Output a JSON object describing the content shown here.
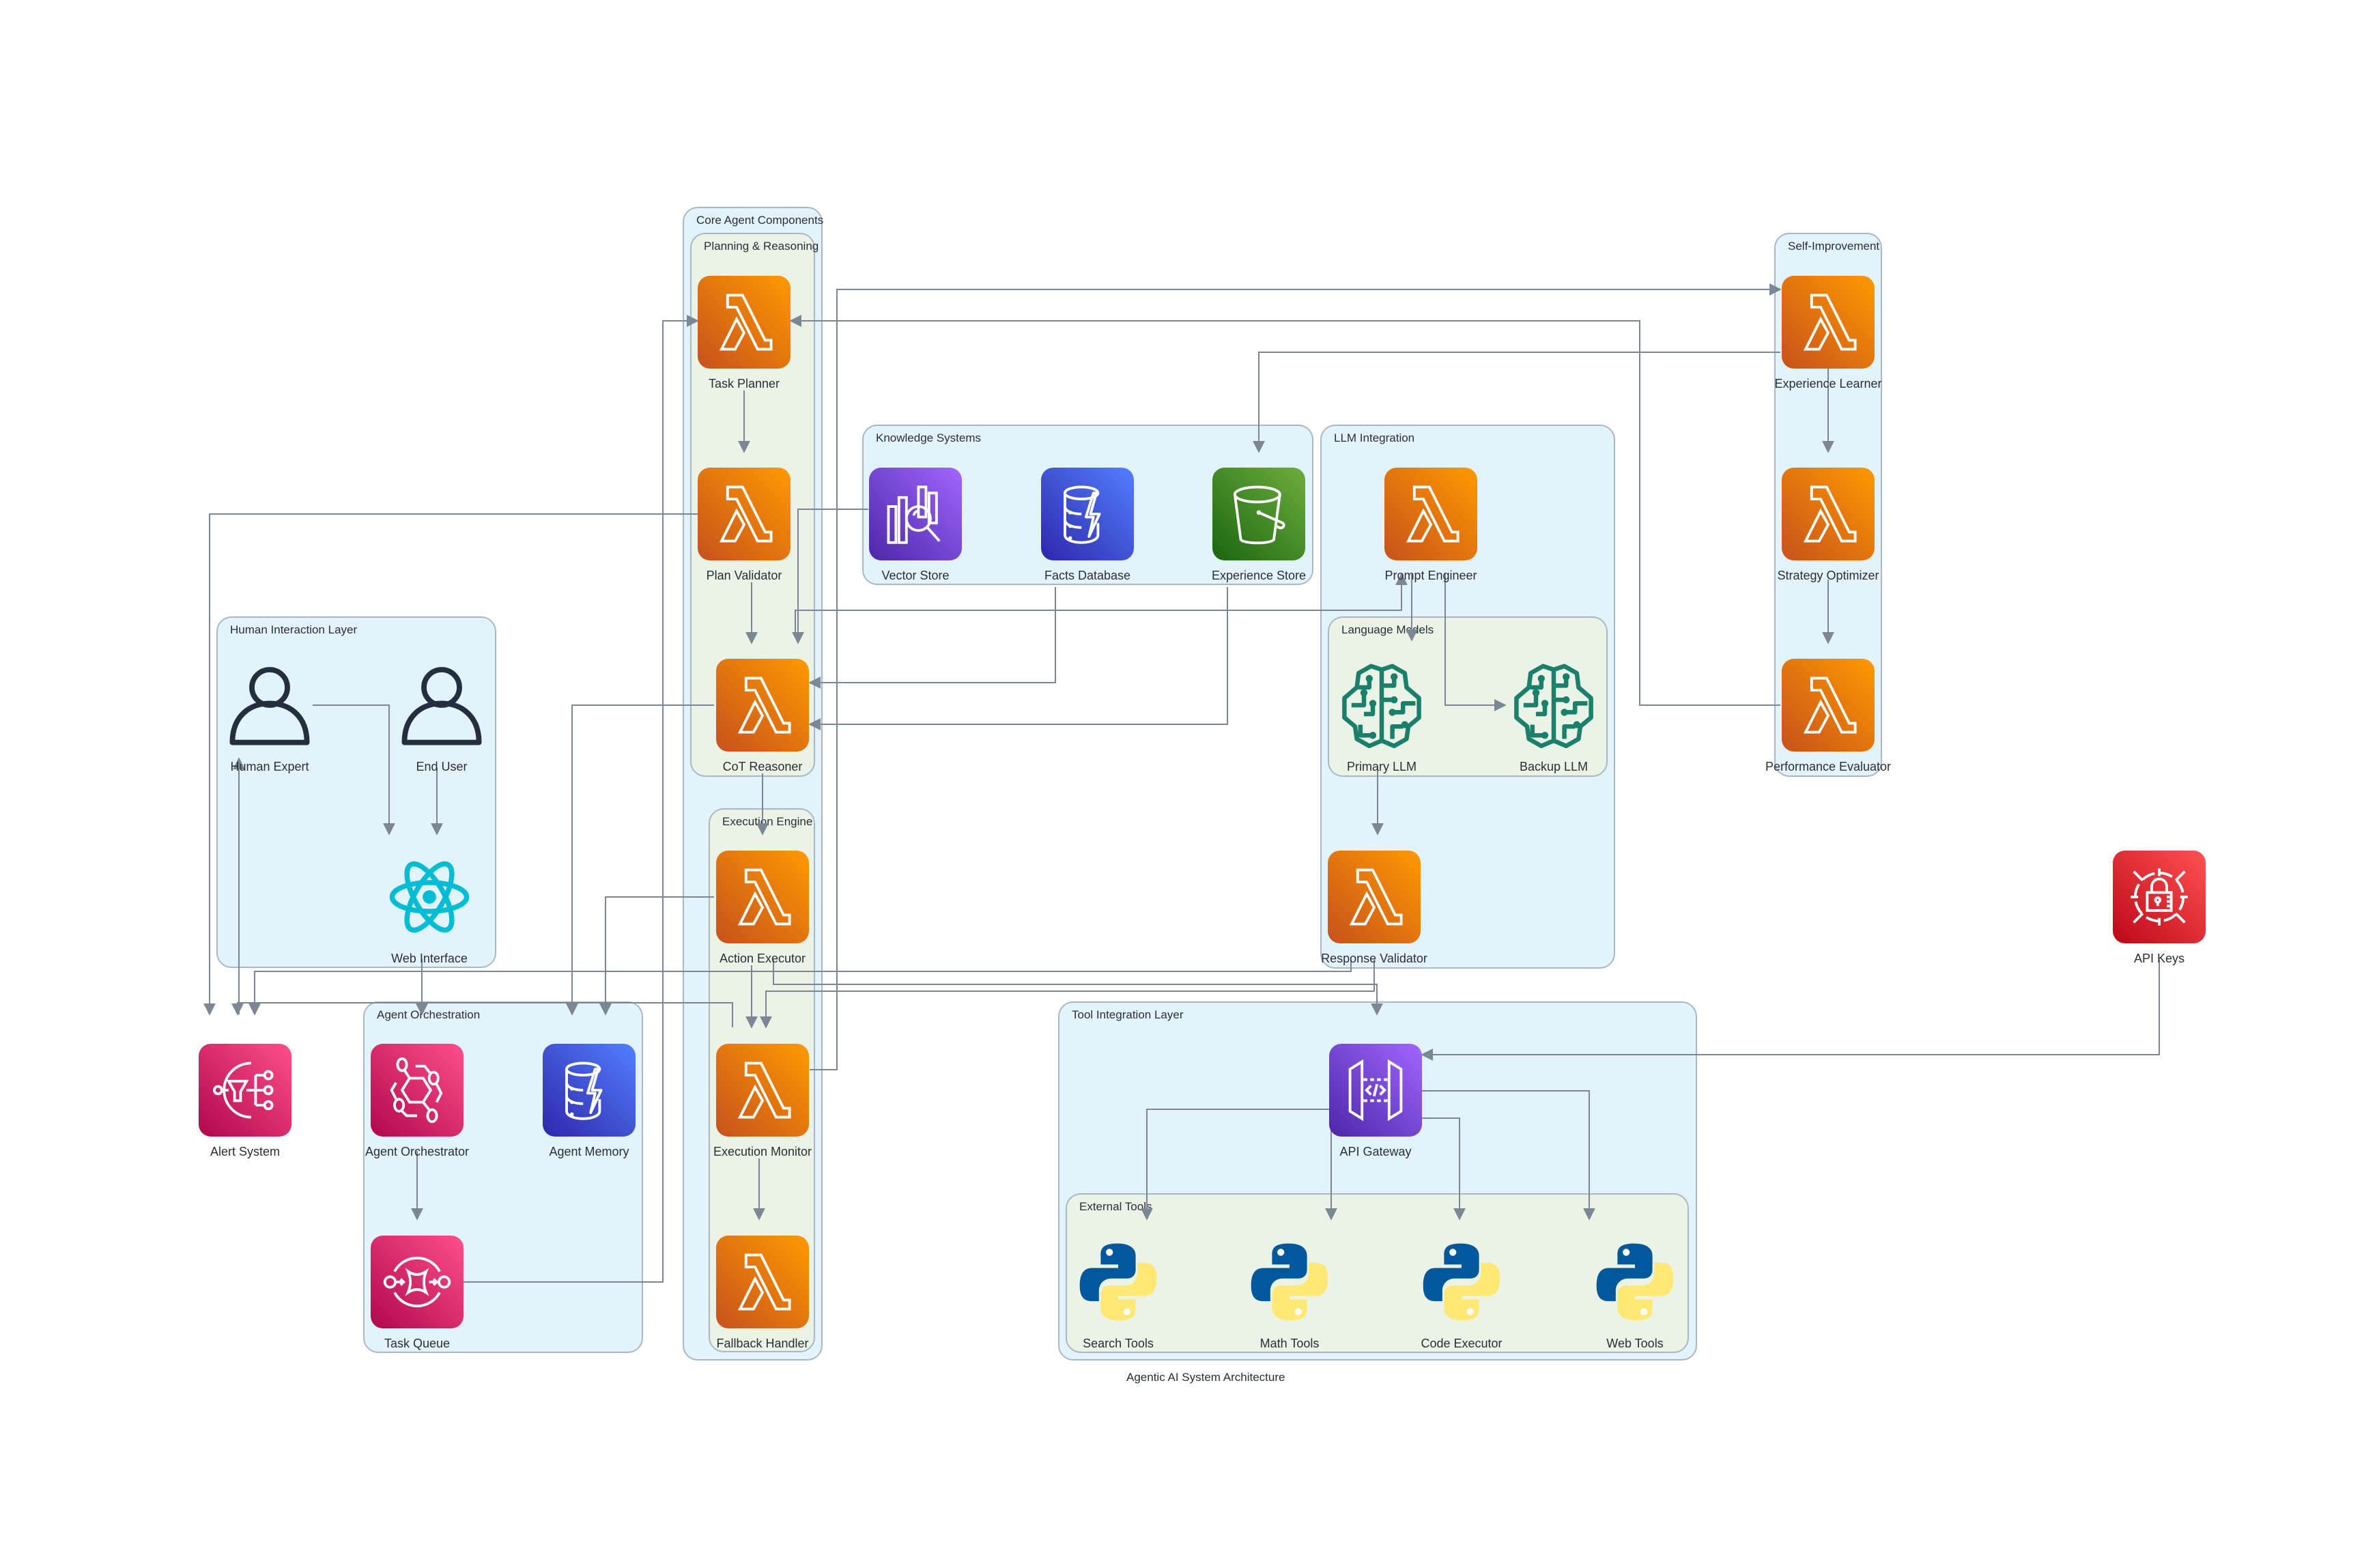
{
  "title": "Agentic AI System Architecture",
  "colors": {
    "edge": "#7b8794",
    "lambda_orange": "#ed7100",
    "application_pink": "#e7157b",
    "database_blue": "#3b48cc",
    "network_purple": "#8c4fff",
    "storage_green": "#3f8624",
    "security_red": "#dd344c",
    "ml_teal": "#1a7f6b",
    "react_cyan": "#00bcd4",
    "python_blue": "#03589c",
    "python_yellow": "#ffe873",
    "cluster_blue": "#e3f3fb",
    "cluster_green": "#ebf2e6"
  },
  "clusters": {
    "core": "Core Agent Components",
    "planning": "Planning & Reasoning",
    "execution": "Execution Engine",
    "knowledge": "Knowledge Systems",
    "llm": "LLM Integration",
    "language_models": "Language Models",
    "self_improvement": "Self-Improvement",
    "human": "Human Interaction Layer",
    "orchestration": "Agent Orchestration",
    "tools": "Tool Integration Layer",
    "external_tools": "External Tools"
  },
  "nodes": {
    "task_planner": {
      "label": "Task Planner",
      "icon": "lambda-icon"
    },
    "plan_validator": {
      "label": "Plan Validator",
      "icon": "lambda-icon"
    },
    "cot_reasoner": {
      "label": "CoT Reasoner",
      "icon": "lambda-icon"
    },
    "action_executor": {
      "label": "Action Executor",
      "icon": "lambda-icon"
    },
    "execution_monitor": {
      "label": "Execution Monitor",
      "icon": "lambda-icon"
    },
    "fallback_handler": {
      "label": "Fallback Handler",
      "icon": "lambda-icon"
    },
    "vector_store": {
      "label": "Vector Store",
      "icon": "vector-search-icon"
    },
    "facts_database": {
      "label": "Facts Database",
      "icon": "dynamodb-icon"
    },
    "experience_store": {
      "label": "Experience Store",
      "icon": "s3-bucket-icon"
    },
    "prompt_engineer": {
      "label": "Prompt Engineer",
      "icon": "lambda-icon"
    },
    "primary_llm": {
      "label": "Primary LLM",
      "icon": "brain-circuit-icon"
    },
    "backup_llm": {
      "label": "Backup LLM",
      "icon": "brain-circuit-icon"
    },
    "response_validator": {
      "label": "Response Validator",
      "icon": "lambda-icon"
    },
    "experience_learner": {
      "label": "Experience Learner",
      "icon": "lambda-icon"
    },
    "strategy_optimizer": {
      "label": "Strategy Optimizer",
      "icon": "lambda-icon"
    },
    "performance_evaluator": {
      "label": "Performance Evaluator",
      "icon": "lambda-icon"
    },
    "human_expert": {
      "label": "Human Expert",
      "icon": "user-icon"
    },
    "end_user": {
      "label": "End User",
      "icon": "user-icon"
    },
    "web_interface": {
      "label": "Web Interface",
      "icon": "react-icon"
    },
    "alert_system": {
      "label": "Alert System",
      "icon": "sns-icon"
    },
    "agent_orchestrator": {
      "label": "Agent Orchestrator",
      "icon": "eventbridge-icon"
    },
    "agent_memory": {
      "label": "Agent Memory",
      "icon": "dynamodb-icon"
    },
    "task_queue": {
      "label": "Task Queue",
      "icon": "sqs-icon"
    },
    "api_gateway": {
      "label": "API Gateway",
      "icon": "api-gateway-icon"
    },
    "search_tools": {
      "label": "Search Tools",
      "icon": "python-icon"
    },
    "math_tools": {
      "label": "Math Tools",
      "icon": "python-icon"
    },
    "code_executor": {
      "label": "Code Executor",
      "icon": "python-icon"
    },
    "web_tools": {
      "label": "Web Tools",
      "icon": "python-icon"
    },
    "api_keys": {
      "label": "API Keys",
      "icon": "secrets-manager-icon"
    }
  },
  "edges": [
    {
      "from": "task_planner",
      "to": "plan_validator"
    },
    {
      "from": "plan_validator",
      "to": "cot_reasoner"
    },
    {
      "from": "cot_reasoner",
      "to": "action_executor"
    },
    {
      "from": "action_executor",
      "to": "execution_monitor"
    },
    {
      "from": "execution_monitor",
      "to": "fallback_handler"
    },
    {
      "from": "vector_store",
      "to": "cot_reasoner"
    },
    {
      "from": "facts_database",
      "to": "cot_reasoner"
    },
    {
      "from": "experience_store",
      "to": "cot_reasoner"
    },
    {
      "from": "cot_reasoner",
      "to": "prompt_engineer"
    },
    {
      "from": "prompt_engineer",
      "to": "primary_llm"
    },
    {
      "from": "prompt_engineer",
      "to": "backup_llm"
    },
    {
      "from": "primary_llm",
      "to": "response_validator"
    },
    {
      "from": "response_validator",
      "to": "alert_system"
    },
    {
      "from": "response_validator",
      "to": "execution_monitor"
    },
    {
      "from": "action_executor",
      "to": "api_gateway"
    },
    {
      "from": "action_executor",
      "to": "agent_memory"
    },
    {
      "from": "cot_reasoner",
      "to": "agent_memory"
    },
    {
      "from": "plan_validator",
      "to": "alert_system"
    },
    {
      "from": "execution_monitor",
      "to": "experience_learner"
    },
    {
      "from": "experience_learner",
      "to": "strategy_optimizer"
    },
    {
      "from": "strategy_optimizer",
      "to": "performance_evaluator"
    },
    {
      "from": "experience_learner",
      "to": "experience_store"
    },
    {
      "from": "performance_evaluator",
      "to": "task_planner"
    },
    {
      "from": "human_expert",
      "to": "web_interface"
    },
    {
      "from": "end_user",
      "to": "web_interface"
    },
    {
      "from": "web_interface",
      "to": "agent_orchestrator"
    },
    {
      "from": "alert_system",
      "to": "human_expert"
    },
    {
      "from": "execution_monitor",
      "to": "alert_system"
    },
    {
      "from": "agent_orchestrator",
      "to": "task_queue"
    },
    {
      "from": "task_queue",
      "to": "task_planner"
    },
    {
      "from": "api_keys",
      "to": "api_gateway"
    },
    {
      "from": "api_gateway",
      "to": "search_tools"
    },
    {
      "from": "api_gateway",
      "to": "math_tools"
    },
    {
      "from": "api_gateway",
      "to": "code_executor"
    },
    {
      "from": "api_gateway",
      "to": "web_tools"
    }
  ]
}
